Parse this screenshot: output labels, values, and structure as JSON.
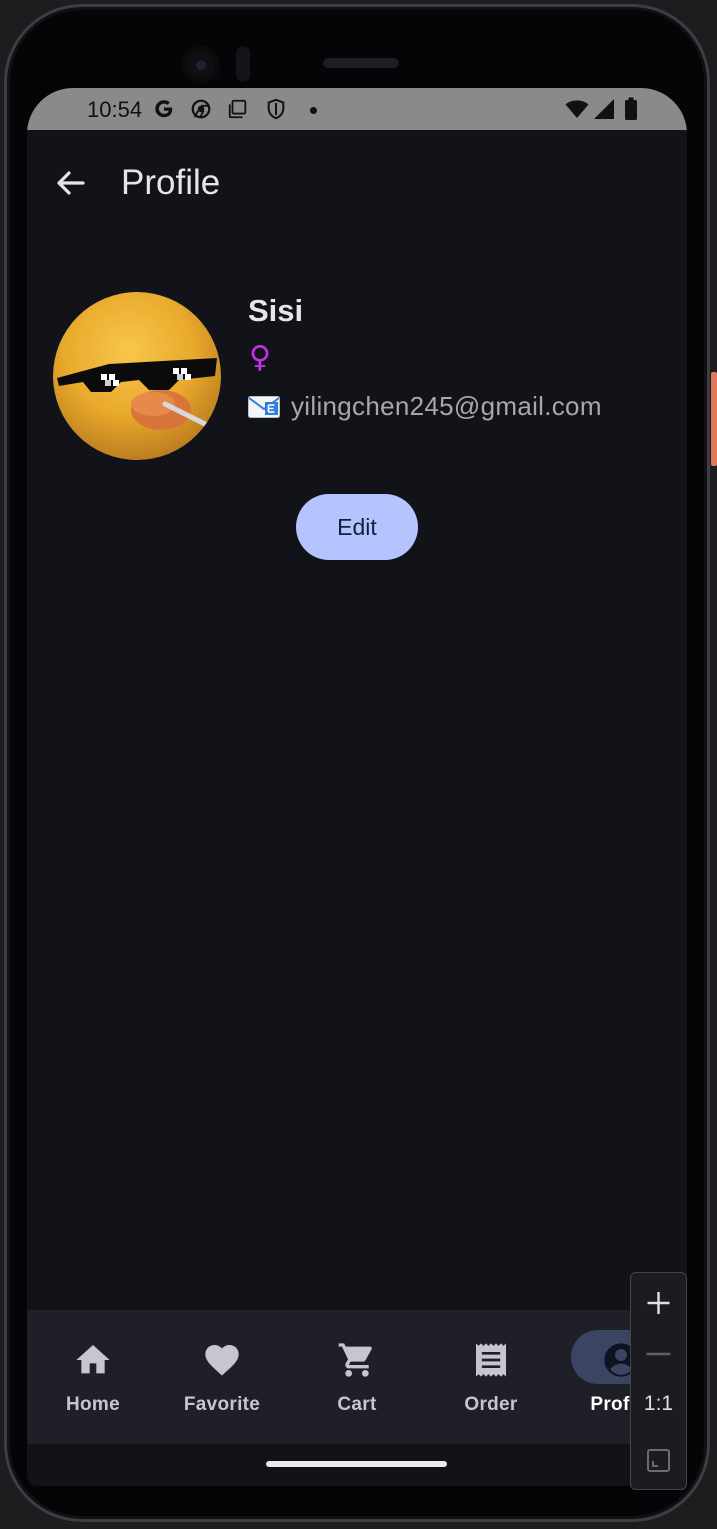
{
  "status_bar": {
    "time": "10:54",
    "icons": [
      "google-g-icon",
      "chrome-icon",
      "screenshot-icon",
      "shield-icon",
      "notification-dot",
      "wifi-icon",
      "signal-icon",
      "battery-icon"
    ]
  },
  "app_bar": {
    "title": "Profile",
    "back_icon": "arrow-back-icon"
  },
  "profile": {
    "name": "Sisi",
    "gender_symbol": "♀",
    "email_icon": "📧",
    "email": "yilingchen245@gmail.com",
    "edit_label": "Edit"
  },
  "bottom_nav": {
    "items": [
      {
        "label": "Home",
        "icon": "home-icon",
        "selected": false
      },
      {
        "label": "Favorite",
        "icon": "heart-icon",
        "selected": false
      },
      {
        "label": "Cart",
        "icon": "cart-icon",
        "selected": false
      },
      {
        "label": "Order",
        "icon": "receipt-icon",
        "selected": false
      },
      {
        "label": "Profile",
        "icon": "account-circle-icon",
        "selected": true
      }
    ]
  },
  "zoom_controls": {
    "ratio": "1:1"
  },
  "colors": {
    "background": "#121318",
    "primary_button": "#b5c4ff",
    "gender": "#c62fe8",
    "nav_background": "#1e1f27",
    "nav_selected_pill": "#3b4463"
  }
}
